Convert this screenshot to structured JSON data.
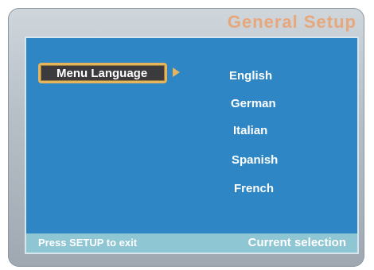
{
  "header": {
    "title": "General Setup"
  },
  "menu": {
    "selected_item": "Menu Language"
  },
  "options": [
    "English",
    "German",
    "Italian",
    "Spanish",
    "French"
  ],
  "footer": {
    "hint": "Press SETUP to exit",
    "status": "Current selection"
  },
  "colors": {
    "panel": "#2e86c4",
    "highlight": "#e6b45a",
    "title": "#e8a77b",
    "footer": "#8fc6d3"
  }
}
